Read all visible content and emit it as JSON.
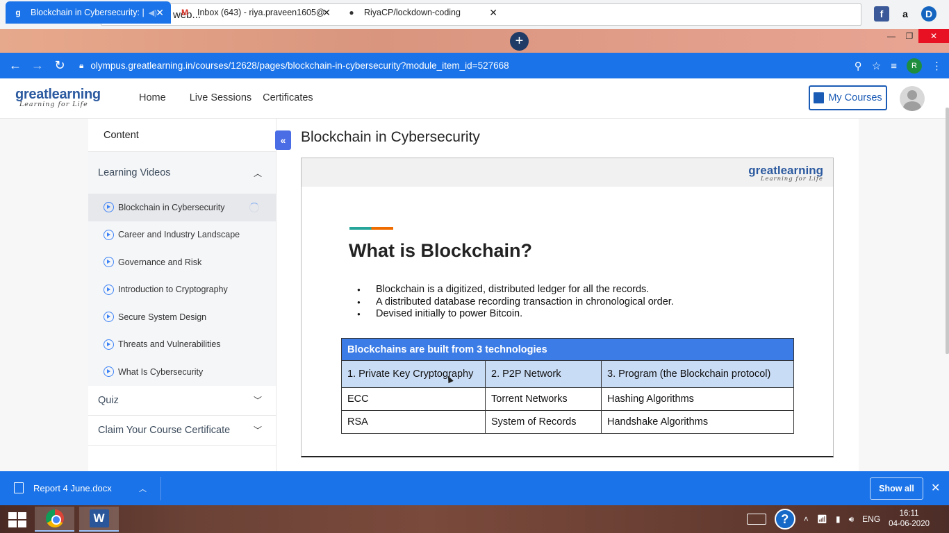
{
  "browser": {
    "search_placeholder": "Search the web...",
    "tabs": [
      {
        "title": "Blockchain in Cybersecurity: |",
        "active": true
      },
      {
        "title": "Inbox (643) - riya.praveen1605@",
        "active": false
      },
      {
        "title": "RiyaCP/lockdown-coding",
        "active": false
      }
    ],
    "url": "olympus.greatlearning.in/courses/12628/pages/blockchain-in-cybersecurity?module_item_id=527668",
    "profile_initial": "R",
    "extension_d": "D"
  },
  "site": {
    "brand_word": "greatlearning",
    "brand_tag": "Learning for Life",
    "nav": [
      "Home",
      "Live Sessions",
      "Certificates"
    ],
    "my_courses": "My Courses"
  },
  "sidebar": {
    "header": "Content",
    "section": "Learning Videos",
    "items": [
      "Blockchain in Cybersecurity",
      "Career and Industry Landscape",
      "Governance and Risk",
      "Introduction to Cryptography",
      "Secure System Design",
      "Threats and Vulnerabilities",
      "What Is Cybersecurity"
    ],
    "quiz": "Quiz",
    "certificate": "Claim Your Course Certificate"
  },
  "main": {
    "title": "Blockchain in Cybersecurity",
    "slide": {
      "brand_word": "greatlearning",
      "brand_tag": "Learning for Life",
      "heading": "What is Blockchain?",
      "bullets": [
        "Blockchain is a digitized, distributed ledger for all the records.",
        "A distributed database recording transaction in chronological order.",
        "Devised initially to power Bitcoin."
      ],
      "table": {
        "header": "Blockchains are built from 3 technologies",
        "subheaders": [
          "1. Private Key Cryptography",
          "2. P2P Network",
          "3. Program (the Blockchain protocol)"
        ],
        "rows": [
          [
            "ECC",
            "Torrent Networks",
            "Hashing Algorithms"
          ],
          [
            "RSA",
            "System of Records",
            "Handshake Algorithms"
          ]
        ]
      }
    }
  },
  "downloads": {
    "file": "Report 4 June.docx",
    "show_all": "Show all"
  },
  "taskbar": {
    "lang": "ENG",
    "time": "16:11",
    "date": "04-06-2020"
  }
}
